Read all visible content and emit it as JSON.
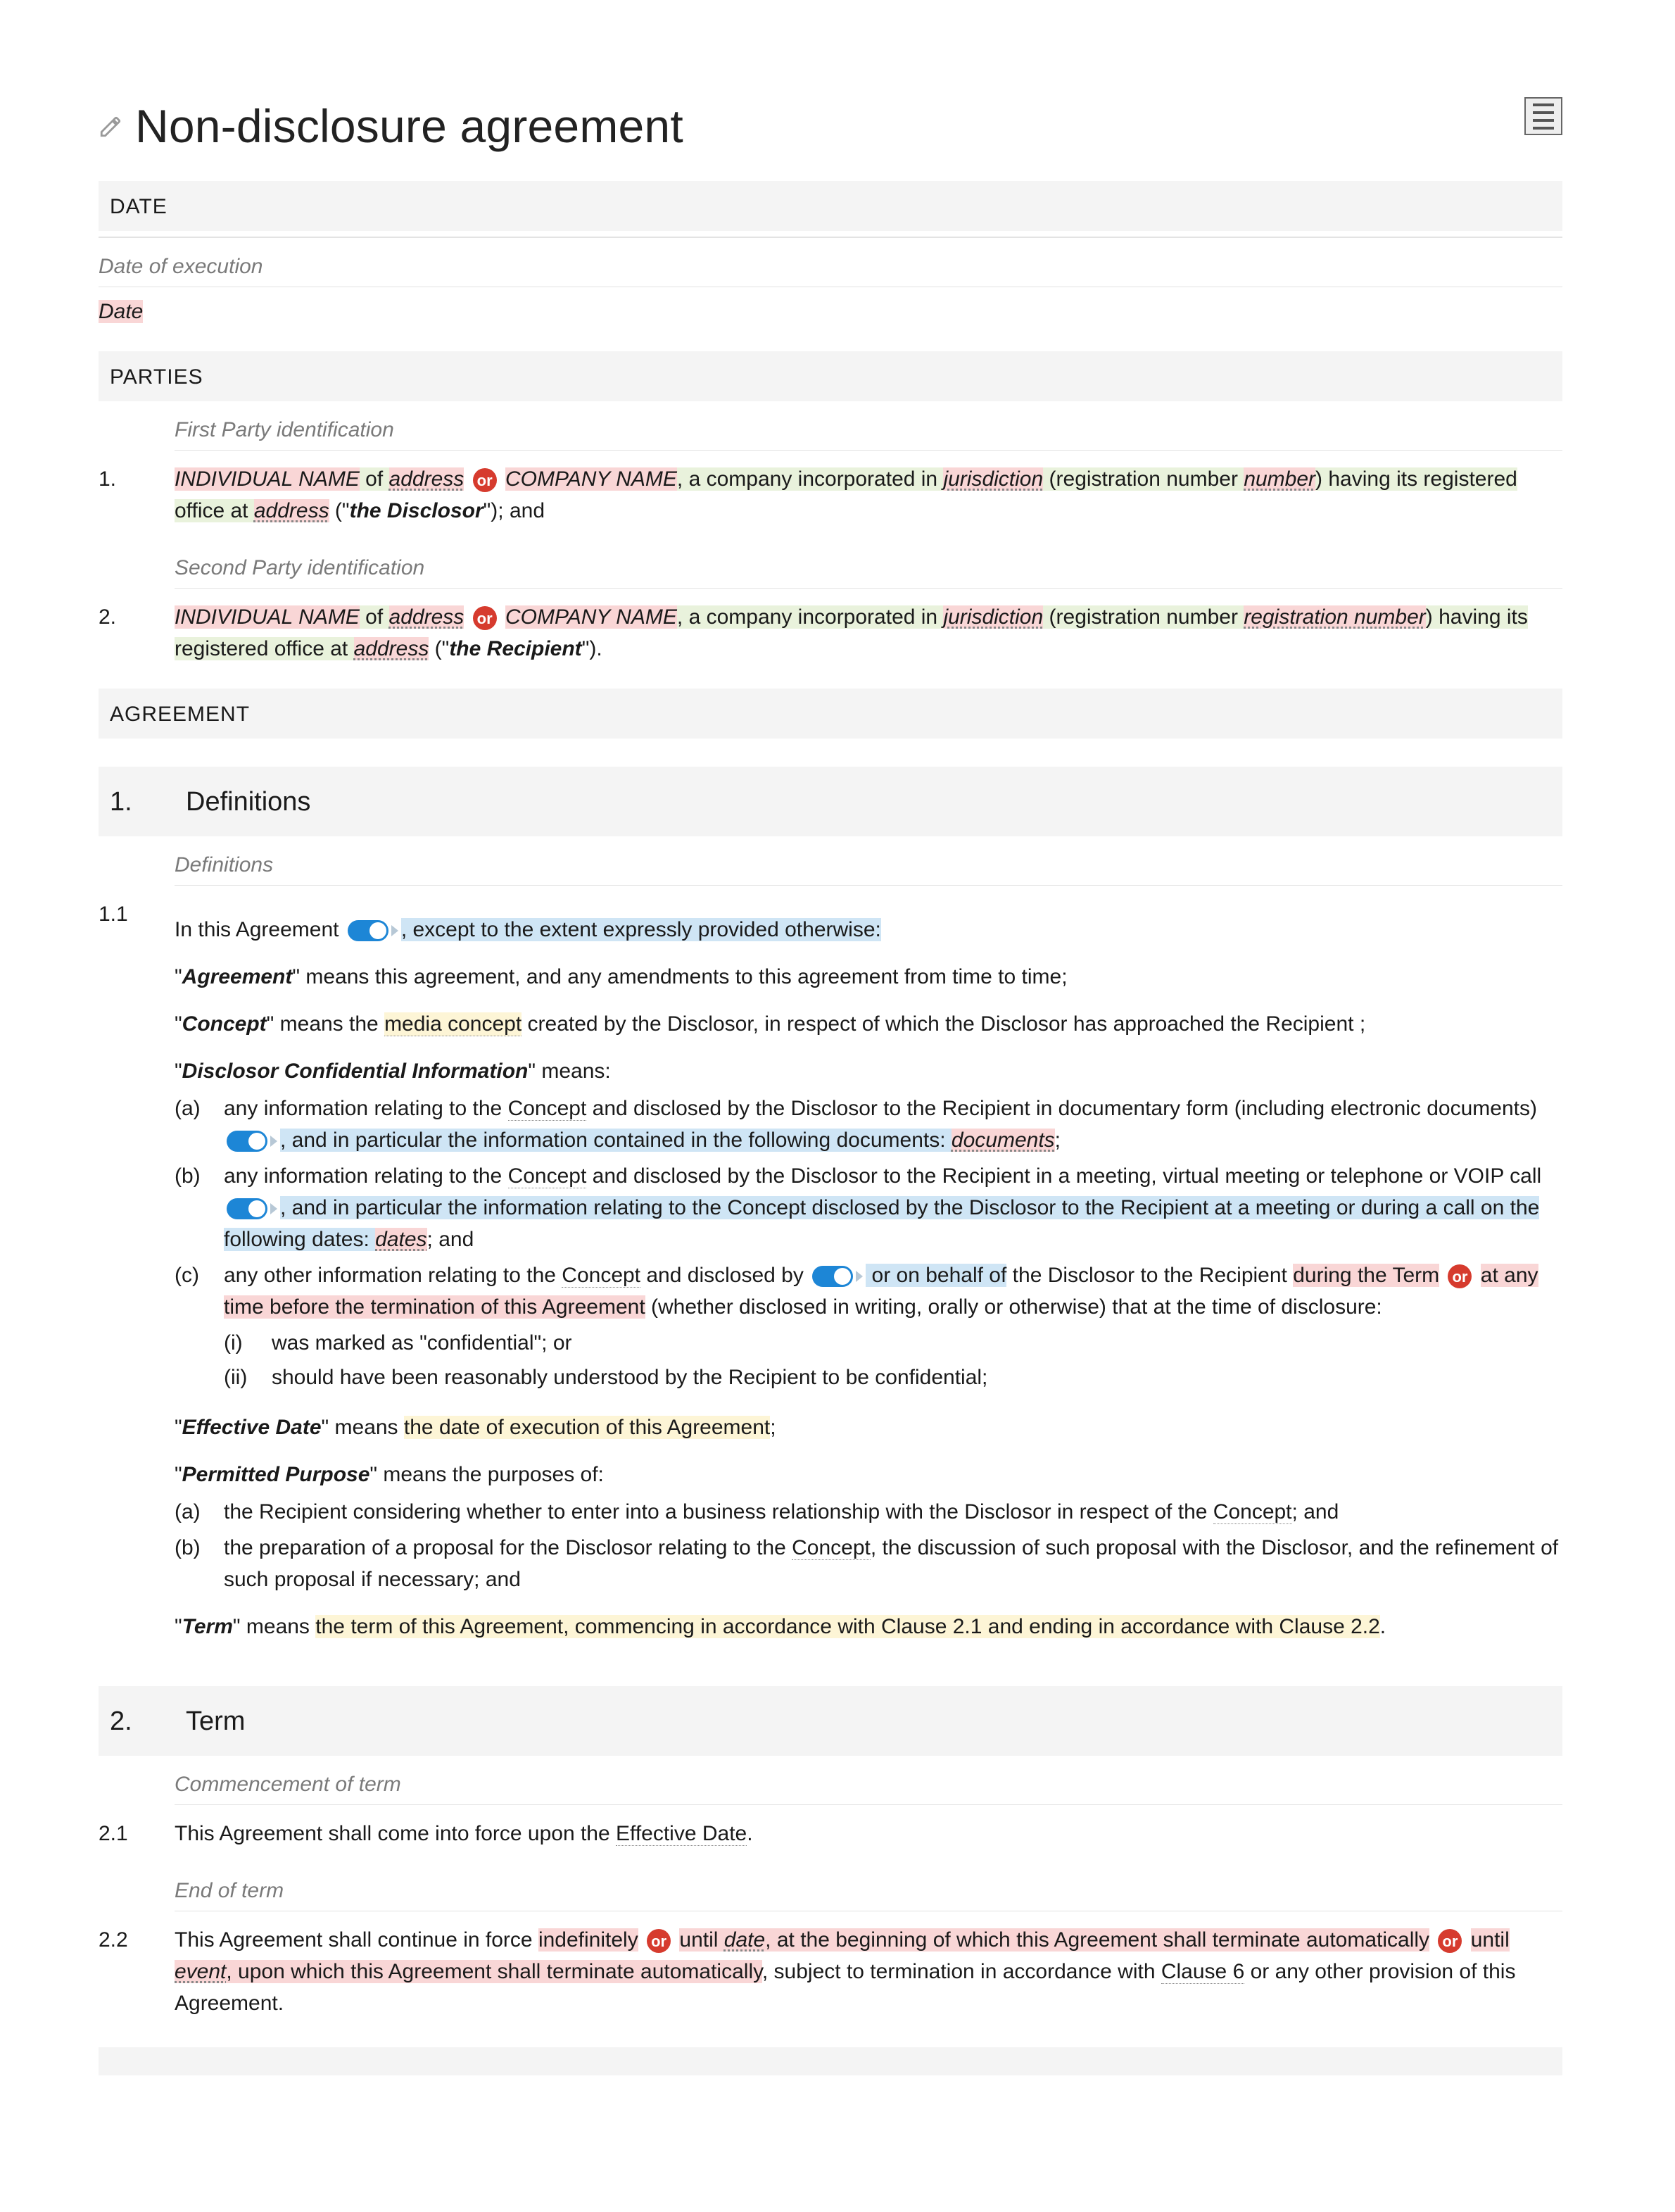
{
  "title": "Non-disclosure agreement",
  "sections": {
    "date": {
      "header": "DATE",
      "desc": "Date of execution",
      "value": "Date"
    },
    "parties": {
      "header": "PARTIES",
      "p1desc": "First Party identification",
      "p2desc": "Second Party identification",
      "num1": "1.",
      "num2": "2.",
      "indName": "INDIVIDUAL NAME",
      "of": " of ",
      "address": "address",
      "compName": "COMPANY NAME",
      "incIn": ", a company incorporated in ",
      "jurisdiction": "jurisdiction",
      "regOpen": " (registration number ",
      "number": "number",
      "regNumber": "registration number",
      "regClose": ") having its registered office at ",
      "disclosor": "the Disclosor",
      "recipient": "the Recipient",
      "and": "\"); and",
      "period": "\")."
    },
    "agreement": {
      "header": "AGREEMENT"
    },
    "definitions": {
      "anum": "1.",
      "atitle": "Definitions",
      "desc": "Definitions",
      "num11": "1.1",
      "intro": "In this Agreement",
      "introTail": ", except to the extent expressly provided otherwise:",
      "agreementTerm": "Agreement",
      "agreementDef": "\" means this agreement, and any amendments to this agreement from time to time;",
      "conceptTerm": "Concept",
      "conceptPre": "\" means the ",
      "conceptMid": "media concept",
      "conceptPost": " created by the Disclosor, in respect of which the Disclosor has approached the Recipient ;",
      "dciTerm": "Disclosor Confidential Information",
      "dciMeans": "\" means:",
      "ma": "(a)",
      "mb": "(b)",
      "mc": "(c)",
      "mi": "(i)",
      "mii": "(ii)",
      "a_pre": "any information relating to the ",
      "concept_dotted": "Concept",
      "a_mid": " and disclosed by the Disclosor to the Recipient in documentary form (including electronic documents) ",
      "a_blue": ", and in particular the information contained in the following documents: ",
      "a_docs": "documents",
      "semi": ";",
      "b_pre": "any information relating to the ",
      "b_mid": " and disclosed by the Disclosor to the Recipient in a meeting, virtual meeting or telephone or VOIP call ",
      "b_blue": ", and in particular the information relating to the Concept disclosed by the Disclosor to the Recipient at a meeting or during a call on the following dates: ",
      "b_dates": "dates",
      "b_tail": "; and",
      "c_pre": "any other information relating to the ",
      "c_mid": " and disclosed by ",
      "c_blue": " or on behalf of",
      "c_post": " the Disclosor to the Recipient ",
      "c_pinkA": "during the Term",
      "c_pinkB": "at any time before the termination of this Agreement",
      "c_tail": " (whether disclosed in writing, orally or otherwise) that at the time of disclosure:",
      "ci": "was marked as \"confidential\"; or",
      "cii": "should have been reasonably understood by the Recipient to be confidential;",
      "effTerm": "Effective Date",
      "effPre": "\" means ",
      "effYellow": "the date of execution of this Agreement",
      "ppTerm": "Permitted Purpose",
      "ppIntro": "\" means the purposes of:",
      "ppa": "the Recipient considering whether to enter into a business relationship with the Disclosor in respect of the ",
      "ppa_tail": "; and",
      "ppb": "the preparation of a proposal for the Disclosor relating to the ",
      "ppb_tail": ", the discussion of such proposal with the Disclosor, and the refinement of such proposal if necessary; and",
      "termTerm": "Term",
      "termPre": "\" means ",
      "termYellow": "the term of this Agreement, commencing in accordance with Clause 2.1 and ending in accordance with Clause 2.2",
      "period": "."
    },
    "term": {
      "anum": "2.",
      "atitle": "Term",
      "desc1": "Commencement of term",
      "num21": "2.1",
      "c21a": "This Agreement shall come into force upon the ",
      "effDate": "Effective Date",
      "desc2": "End of term",
      "num22": "2.2",
      "c22a": "This Agreement shall continue in force ",
      "c22_indef": "indefinitely",
      "c22_untilDate": " until ",
      "c22_date": "date",
      "c22_mid": ", at the beginning of which this Agreement shall terminate automatically",
      "c22_untilEvent": " until ",
      "c22_event": "event",
      "c22_mid2": ", upon which this Agreement shall terminate automatically",
      "c22_tail": ", subject to termination in accordance with ",
      "clause6": "Clause 6",
      "c22_tail2": " or any other provision of this Agreement.",
      "period": "."
    }
  },
  "labels": {
    "or": "or"
  }
}
